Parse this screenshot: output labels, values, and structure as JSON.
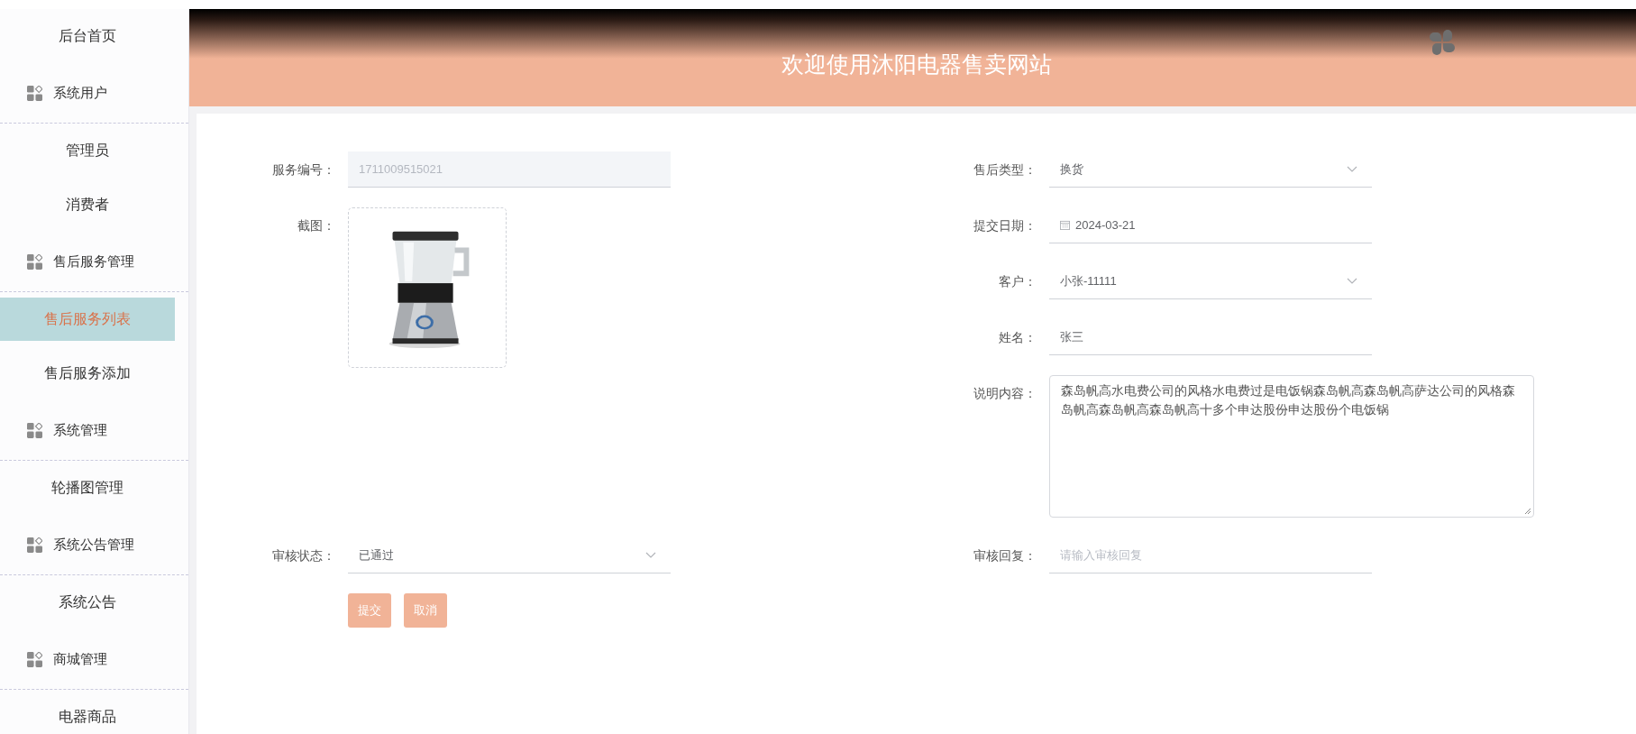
{
  "header": {
    "title": "欢迎使用沐阳电器售卖网站"
  },
  "sidebar": {
    "items": [
      {
        "label": "后台首页",
        "kind": "link",
        "selected": false
      },
      {
        "label": "系统用户",
        "kind": "group",
        "children": [
          {
            "label": "管理员",
            "selected": false
          },
          {
            "label": "消费者",
            "selected": false
          }
        ]
      },
      {
        "label": "售后服务管理",
        "kind": "group",
        "children": [
          {
            "label": "售后服务列表",
            "selected": true
          },
          {
            "label": "售后服务添加",
            "selected": false
          }
        ]
      },
      {
        "label": "系统管理",
        "kind": "group",
        "children": [
          {
            "label": "轮播图管理",
            "selected": false
          }
        ]
      },
      {
        "label": "系统公告管理",
        "kind": "group",
        "children": [
          {
            "label": "系统公告",
            "selected": false
          }
        ]
      },
      {
        "label": "商城管理",
        "kind": "group",
        "children": [
          {
            "label": "电器商品",
            "selected": false
          }
        ]
      }
    ]
  },
  "form": {
    "blocks": [
      {
        "left": [
          {
            "label": "服务编号：",
            "kind": "input",
            "value": "1711009515021",
            "disabled": true
          },
          {
            "label": "截图："
          }
        ],
        "right": [
          {
            "label": "售后类型：",
            "kind": "select",
            "value": "换货"
          },
          {
            "label": "提交日期：",
            "kind": "date",
            "value": "2024-03-21"
          },
          {
            "label": "客户：",
            "kind": "select",
            "value": "小张-11111"
          },
          {
            "label": "姓名：",
            "kind": "input",
            "value": "张三",
            "disabled": false
          },
          {
            "label": "说明内容：",
            "kind": "textarea",
            "value": "森岛帆高水电费公司的风格水电费过是电饭锅森岛帆高森岛帆高萨达公司的风格森岛帆高森岛帆高森岛帆高十多个申达股份申达股份个电饭锅"
          }
        ]
      },
      {
        "left": [
          {
            "label": "审核状态：",
            "kind": "select",
            "value": "已通过"
          }
        ],
        "right": [
          {
            "label": "审核回复：",
            "kind": "input",
            "placeholder": "请输入审核回复",
            "disabled": false
          }
        ]
      }
    ],
    "buttons": [
      {
        "label": "提交"
      },
      {
        "label": "取消"
      }
    ]
  }
}
